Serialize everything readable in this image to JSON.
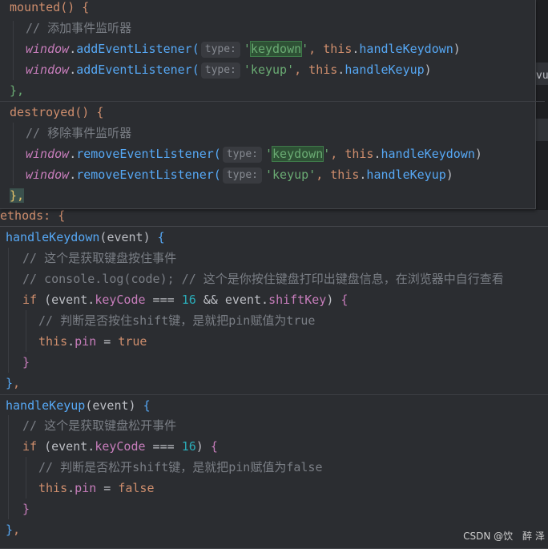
{
  "top_snippet": {
    "mounted_header": "mounted() {",
    "mounted_comment": "// 添加事件监听器",
    "add_window": "window",
    "add_method": "addEventListener(",
    "hint_type": "type:",
    "add_kd_event": "keydown",
    "add_kd_handler": "handleKeydown",
    "add_ku_event": "keyup",
    "add_ku_handler": "handleKeyup",
    "mounted_close": "},",
    "destroyed_header": "destroyed() {",
    "destroyed_comment": "// 移除事件监听器",
    "remove_method": "removeEventListener(",
    "destroyed_close": "},",
    "methods_line": "ethods: {"
  },
  "bottom_snippet": {
    "kd_header_name": "handleKeydown",
    "kd_param": "event",
    "kd_comment1": "// 这个是获取键盘按住事件",
    "kd_comment2": "// console.log(code); // 这个是你按住键盘打印出键盘信息，在浏览器中自行查看",
    "kd_if_obj": "event",
    "kd_if_prop": "keyCode",
    "kd_if_num": "16",
    "kd_if_prop2": "shiftKey",
    "kd_inner_comment": "// 判断是否按住shift键，是就把pin赋值为true",
    "kd_assign_prop": "pin",
    "kd_assign_val": "true",
    "ku_header_name": "handleKeyup",
    "ku_param": "event",
    "ku_comment1": "// 这个是获取键盘松开事件",
    "ku_if_num": "16",
    "ku_inner_comment": "// 判断是否松开shift键，是就把pin赋值为false",
    "ku_assign_val": "false"
  },
  "keywords": {
    "this": "this",
    "if": "if"
  },
  "right_edge_text": "vu",
  "watermark": "CSDN @饮　醉 泽",
  "colors": {
    "background": "#2b2d31",
    "keyword": "#cf8e6d",
    "function": "#56a8f5",
    "property": "#c77dbb",
    "string": "#6aab73",
    "number": "#2aacb8",
    "comment": "#7a7e85"
  }
}
